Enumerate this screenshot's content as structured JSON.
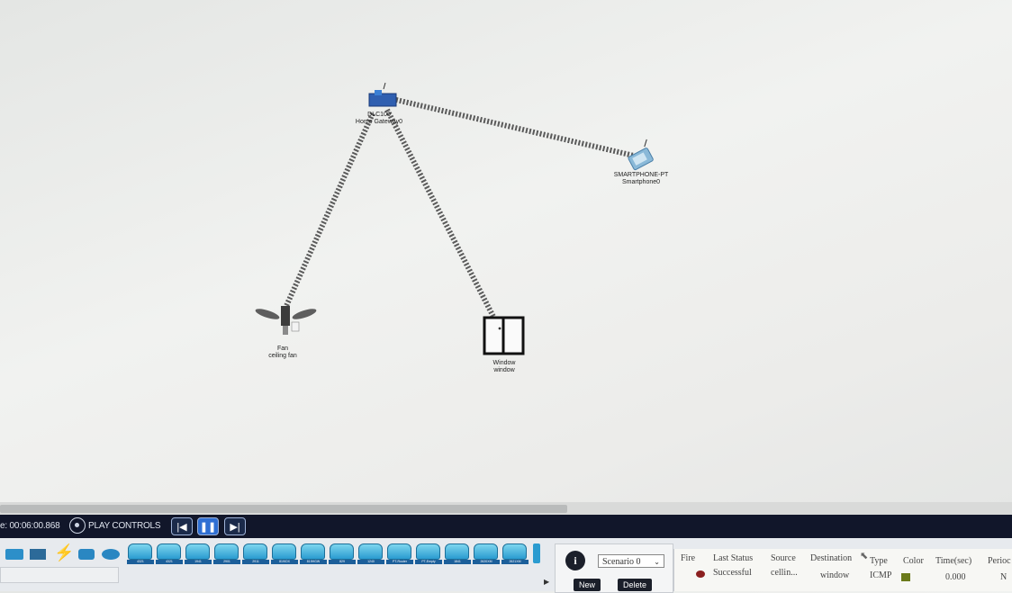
{
  "topology": {
    "devices": [
      {
        "id": "home-gateway",
        "model": "DLC100",
        "name": "Home Gateway0"
      },
      {
        "id": "smartphone",
        "model": "SMARTPHONE-PT",
        "name": "Smartphone0"
      },
      {
        "id": "fan",
        "model": "Fan",
        "name": "ceiling fan"
      },
      {
        "id": "window",
        "model": "Window",
        "name": "window"
      }
    ]
  },
  "play_controls": {
    "time_text": "e: 00:06:00.868",
    "label": "PLAY CONTROLS",
    "back_icon": "|◀",
    "pause_icon": "❚❚",
    "forward_icon": "▶|"
  },
  "device_palette": {
    "items": [
      "4321",
      "4321",
      "1941",
      "2901",
      "2911",
      "819IOX",
      "819HGW",
      "829",
      "1240",
      "PT-Router",
      "PT-Empty",
      "1841",
      "2620XM",
      "2621XM"
    ]
  },
  "scenario": {
    "info_icon": "i",
    "selected": "Scenario 0",
    "new_label": "New",
    "delete_label": "Delete"
  },
  "pdu_table": {
    "headers": [
      "Fire",
      "Last Status",
      "Source",
      "Destination",
      "Type",
      "Color",
      "Time(sec)",
      "Perioc"
    ],
    "rows": [
      {
        "last_status": "Successful",
        "source": "cellin...",
        "destination": "window",
        "type": "ICMP",
        "color": "#6b7a1a",
        "time": "0.000",
        "periodic": "N"
      }
    ]
  }
}
